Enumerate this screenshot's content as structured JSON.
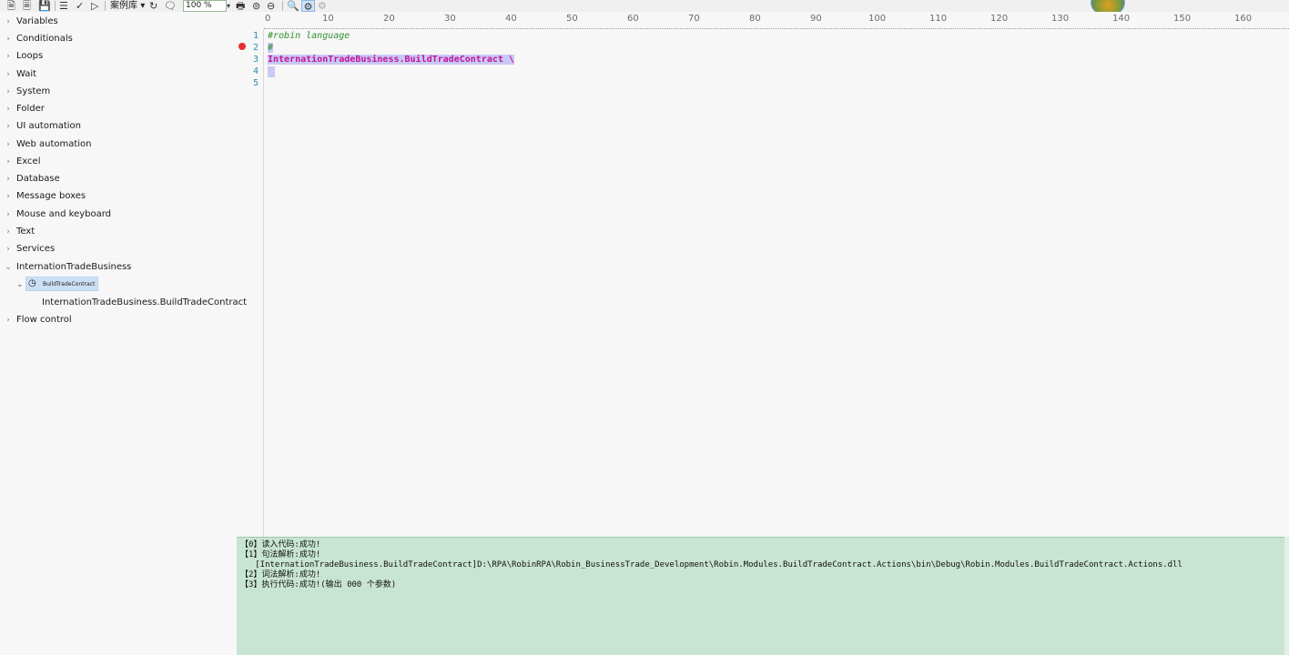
{
  "toolbar": {
    "icons": [
      "new-file-icon",
      "open-file-icon",
      "save-icon",
      "list-icon",
      "check-icon",
      "run-icon",
      "refresh-icon",
      "comment-icon",
      "print-icon",
      "stop-icon",
      "minus-circle-icon",
      "search-icon",
      "run-debug-icon",
      "disabled-icon"
    ],
    "library_label": "案例库",
    "zoom_value": "100 %"
  },
  "sidebar": {
    "items": [
      {
        "label": "Variables"
      },
      {
        "label": "Conditionals"
      },
      {
        "label": "Loops"
      },
      {
        "label": "Wait"
      },
      {
        "label": "System"
      },
      {
        "label": "Folder"
      },
      {
        "label": "UI automation"
      },
      {
        "label": "Web automation"
      },
      {
        "label": "Excel"
      },
      {
        "label": "Database"
      },
      {
        "label": "Message boxes"
      },
      {
        "label": "Mouse and keyboard"
      },
      {
        "label": "Text"
      },
      {
        "label": "Services"
      },
      {
        "label": "InternationTradeBusiness"
      },
      {
        "label": "Flow control"
      }
    ],
    "sub_node_label": "BuildTradeContract",
    "leaf_label": "InternationTradeBusiness.BuildTradeContract"
  },
  "ruler": {
    "ticks": [
      "0",
      "10",
      "20",
      "30",
      "40",
      "50",
      "60",
      "70",
      "80",
      "90",
      "100",
      "110",
      "120",
      "130",
      "140",
      "150",
      "160"
    ]
  },
  "editor": {
    "line_numbers": [
      "1",
      "2",
      "3",
      "4",
      "5"
    ],
    "lines": [
      "#robin language",
      "#",
      "InternationTradeBusiness.BuildTradeContract \\",
      "",
      ""
    ]
  },
  "output": {
    "lines": [
      "【0】读入代码:成功!",
      "【1】句法解析:成功!",
      "   [InternationTradeBusiness.BuildTradeContract]D:\\RPA\\RobinRPA\\Robin_BusinessTrade_Development\\Robin.Modules.BuildTradeContract.Actions\\bin\\Debug\\Robin.Modules.BuildTradeContract.Actions.dll",
      "【2】词法解析:成功!",
      "【3】执行代码:成功!(输出 000 个参数)"
    ]
  },
  "colors": {
    "output_bg": "#c8e4d2",
    "comment": "#2f8f2f",
    "function_call": "#c4149a",
    "selection": "#c9c9f5",
    "line_number": "#2b8ca6",
    "breakpoint": "#e53030"
  }
}
